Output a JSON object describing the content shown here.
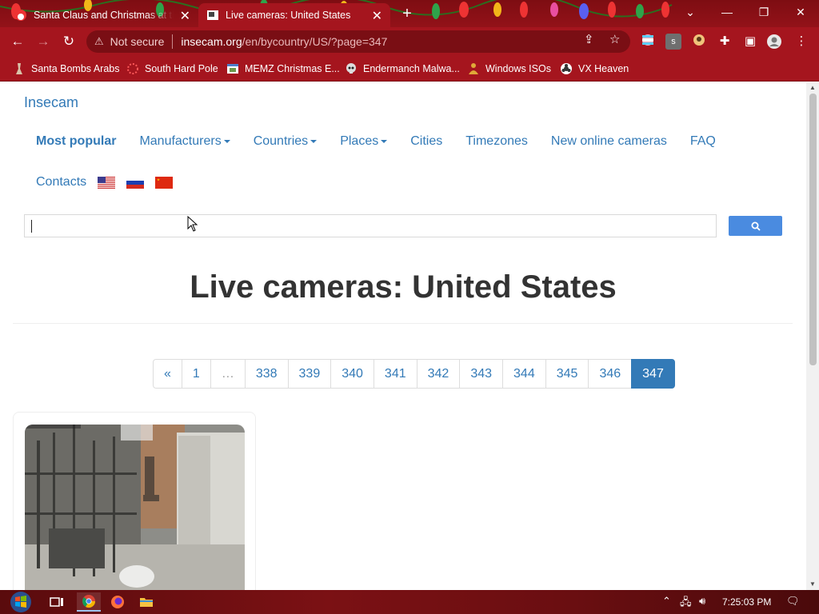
{
  "browser": {
    "tabs": [
      {
        "title": "Santa Claus and Christmas at the"
      },
      {
        "title": "Live cameras: United States"
      }
    ],
    "address": {
      "security_label": "Not secure",
      "url_host": "insecam.org",
      "url_path": "/en/bycountry/US/?page=347"
    },
    "bookmarks": [
      {
        "label": "Santa Bombs Arabs"
      },
      {
        "label": "South Hard Pole"
      },
      {
        "label": "MEMZ Christmas E..."
      },
      {
        "label": "Endermanch Malwa..."
      },
      {
        "label": "Windows ISOs"
      },
      {
        "label": "VX Heaven"
      }
    ],
    "profile_badge": "s"
  },
  "site": {
    "brand": "Insecam",
    "nav": {
      "most_popular": "Most popular",
      "manufacturers": "Manufacturers",
      "countries": "Countries",
      "places": "Places",
      "cities": "Cities",
      "timezones": "Timezones",
      "new_cameras": "New online cameras",
      "faq": "FAQ",
      "contacts": "Contacts"
    },
    "search": {
      "value": ""
    },
    "title": "Live cameras: United States",
    "pagination": {
      "prev": "«",
      "pages": [
        "1",
        "…",
        "338",
        "339",
        "340",
        "341",
        "342",
        "343",
        "344",
        "345",
        "346"
      ],
      "current": "347"
    }
  },
  "taskbar": {
    "clock": "7:25:03 PM"
  },
  "colors": {
    "link": "#337ab7",
    "chrome": "#a5151e",
    "active_page": "#337ab7"
  }
}
